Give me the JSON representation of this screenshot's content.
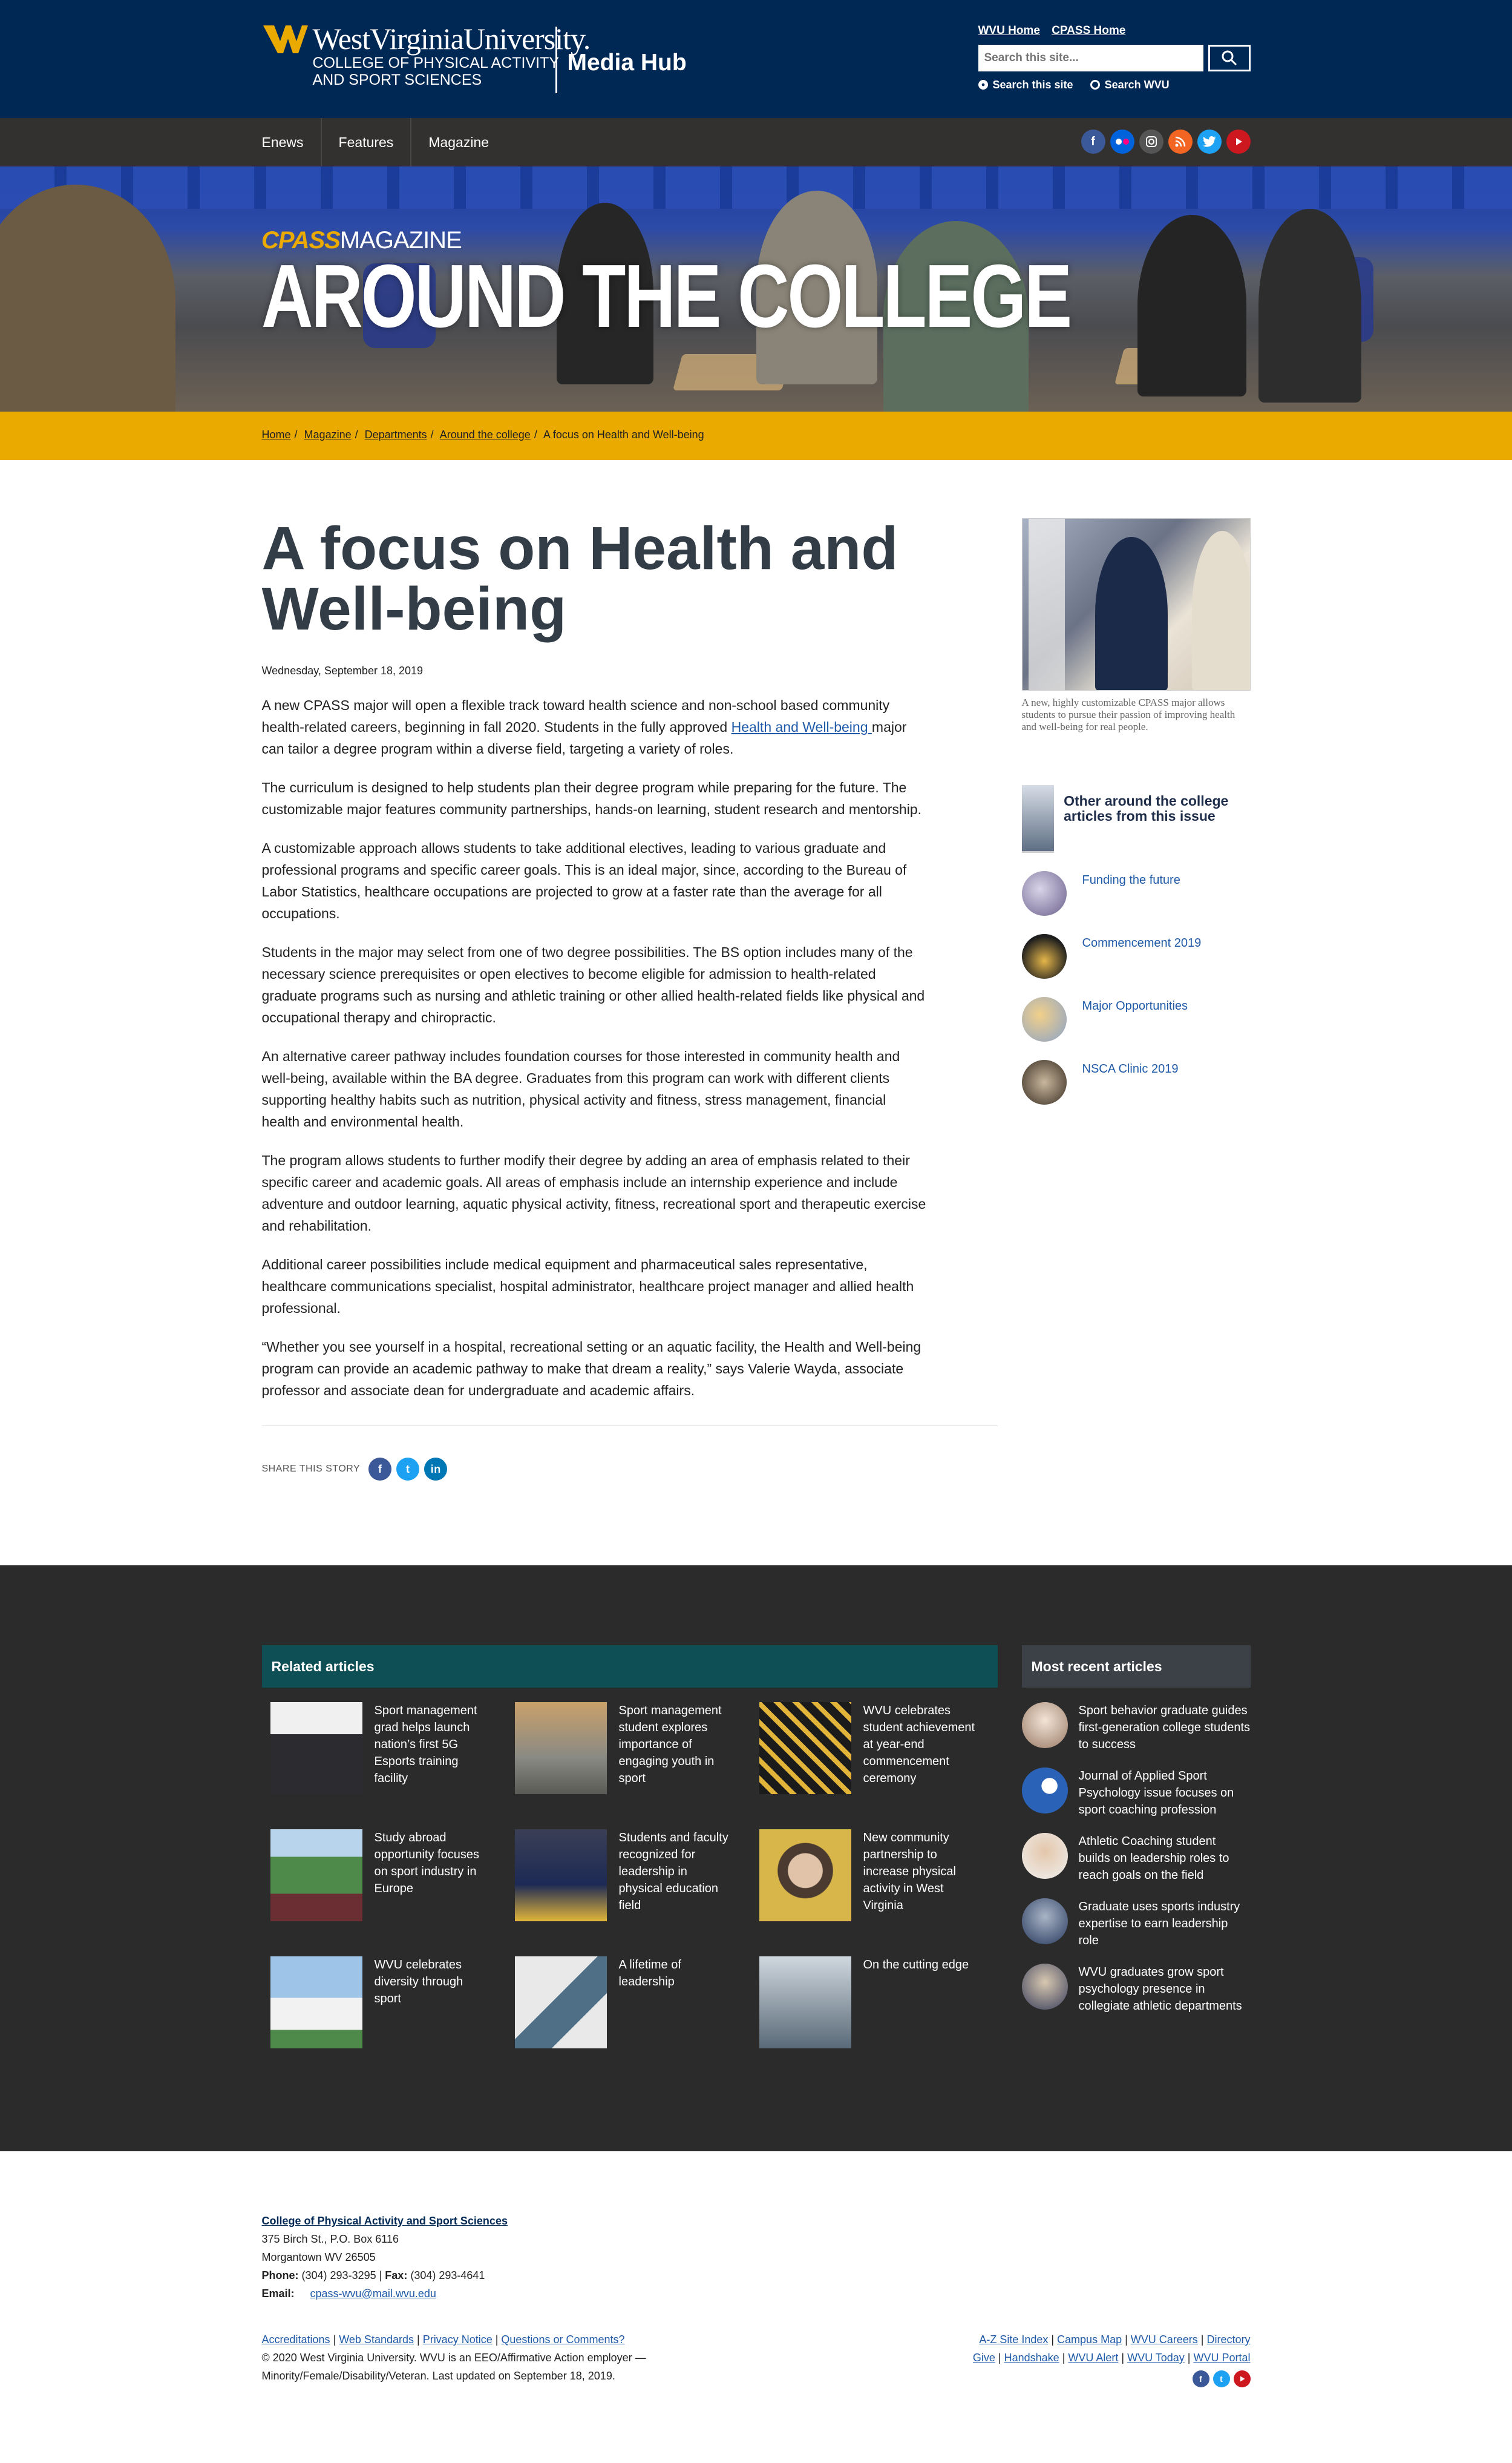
{
  "header": {
    "university": "WestVirginiaUniversity.",
    "college_line1": "COLLEGE OF PHYSICAL ACTIVITY",
    "college_line2": "AND SPORT SCIENCES",
    "site_name": "Media Hub",
    "quick_links": [
      "WVU Home",
      "CPASS Home"
    ],
    "search_placeholder": "Search this site...",
    "radio_options": [
      "Search this site",
      "Search WVU"
    ]
  },
  "nav": {
    "items": [
      "Enews",
      "Features",
      "Magazine"
    ],
    "social_icons": [
      "facebook-icon",
      "flickr-icon",
      "instagram-icon",
      "rss-icon",
      "twitter-icon",
      "youtube-icon"
    ],
    "social_colors": [
      "#3b5998",
      "#0063dc",
      "#555555",
      "#f26522",
      "#1da1f2",
      "#cc181e"
    ]
  },
  "hero": {
    "mag_prefix": "CPASS",
    "mag_suffix": "MAGAZINE",
    "title": "AROUND THE COLLEGE"
  },
  "breadcrumb": [
    "Home",
    "Magazine",
    "Departments",
    "Around the college",
    "A focus on Health and Well-being"
  ],
  "article": {
    "title_line1": "A focus on Health and",
    "title_line2": "Well-being",
    "date": "Wednesday, September 18, 2019",
    "p1_pre": "A new CPASS major will open a flexible track toward health science and non-school based community health-related careers, beginning in fall 2020. Students in the fully approved ",
    "p1_link": "Health and Well-being ",
    "p1_post": "major can tailor a degree program within a diverse field, targeting a variety of roles.",
    "paragraphs": [
      "The curriculum is designed to help students plan their degree program while preparing for the future. The customizable major features community partnerships, hands-on learning, student research and mentorship.",
      "A customizable approach allows students to take additional electives, leading to various graduate and professional programs and specific career goals. This is an ideal major, since, according to the Bureau of Labor Statistics, healthcare occupations are projected to grow at a faster rate than the average for all occupations.",
      "Students in the major may select from one of two degree possibilities. The BS option includes many of the necessary science prerequisites or open electives to become eligible for admission to health-related graduate programs such as nursing and athletic training or other allied health-related fields like physical and occupational therapy and chiropractic.",
      "An alternative career pathway includes foundation courses for those interested in community health and well-being, available within the BA degree. Graduates from this program can work with different clients supporting healthy habits such as nutrition, physical activity and fitness, stress management, financial health and environmental health.",
      "The program allows students to further modify their degree by adding an area of emphasis related to their specific career and academic goals. All areas of emphasis include an internship experience and include adventure and outdoor learning, aquatic physical activity, fitness, recreational sport and therapeutic exercise and rehabilitation.",
      "Additional career possibilities include medical equipment and pharmaceutical sales representative, healthcare communications specialist, hospital administrator, healthcare project manager and allied health professional.",
      "“Whether you see yourself in a hospital, recreational setting or an aquatic facility, the Health and Well-being program can provide an academic pathway to make that dream a reality,” says Valerie Wayda, associate professor and associate dean for undergraduate and academic affairs."
    ],
    "share_label": "SHARE THIS STORY"
  },
  "sidebar": {
    "caption": "A new, highly customizable CPASS major allows students to pursue their passion of improving health and well-being for real people.",
    "others_title": "Other around the college articles from this issue",
    "others": [
      "Funding the future",
      "Commencement 2019",
      "Major Opportunities",
      "NSCA Clinic 2019"
    ]
  },
  "related": {
    "heading": "Related articles",
    "items": [
      "Sport management grad helps launch nation’s first 5G Esports training facility",
      "Sport management student explores importance of engaging youth in sport",
      "WVU celebrates student achievement at year-end commencement ceremony",
      "Study abroad opportunity focuses on sport industry in Europe",
      "Students and faculty recognized for leadership in physical education field",
      "New community partnership to increase physical activity in West Virginia",
      "WVU celebrates diversity through sport",
      "A lifetime of leadership",
      "On the cutting edge"
    ],
    "recent_heading": "Most recent articles",
    "recent": [
      "Sport behavior graduate guides first-generation college students to success",
      "Journal of Applied Sport Psychology issue focuses on sport coaching profession",
      "Athletic Coaching student builds on leadership roles to reach goals on the field",
      "Graduate uses sports industry expertise to earn leadership role",
      "WVU graduates grow sport psychology presence in collegiate athletic departments"
    ]
  },
  "footer": {
    "college": "College of Physical Activity and Sport Sciences",
    "address1": "375 Birch St., P.O. Box 6116",
    "address2": "Morgantown WV 26505",
    "phone_label": "Phone:",
    "phone": "(304) 293-3295",
    "fax_label": "Fax:",
    "fax": "(304) 293-4641",
    "email_label": "Email:",
    "email": "cpass-wvu@mail.wvu.edu",
    "links_left": [
      "Accreditations",
      "Web Standards",
      "Privacy Notice",
      "Questions or Comments?"
    ],
    "copyright": "© 2020 West Virginia University. WVU is an EEO/Affirmative Action employer — Minority/Female/Disability/Veteran. Last updated on September 18, 2019.",
    "links_right_1": [
      "A-Z Site Index",
      "Campus Map",
      "WVU Careers",
      "Directory"
    ],
    "links_right_2": [
      "Give",
      "Handshake",
      "WVU Alert",
      "WVU Today",
      "WVU Portal"
    ]
  }
}
